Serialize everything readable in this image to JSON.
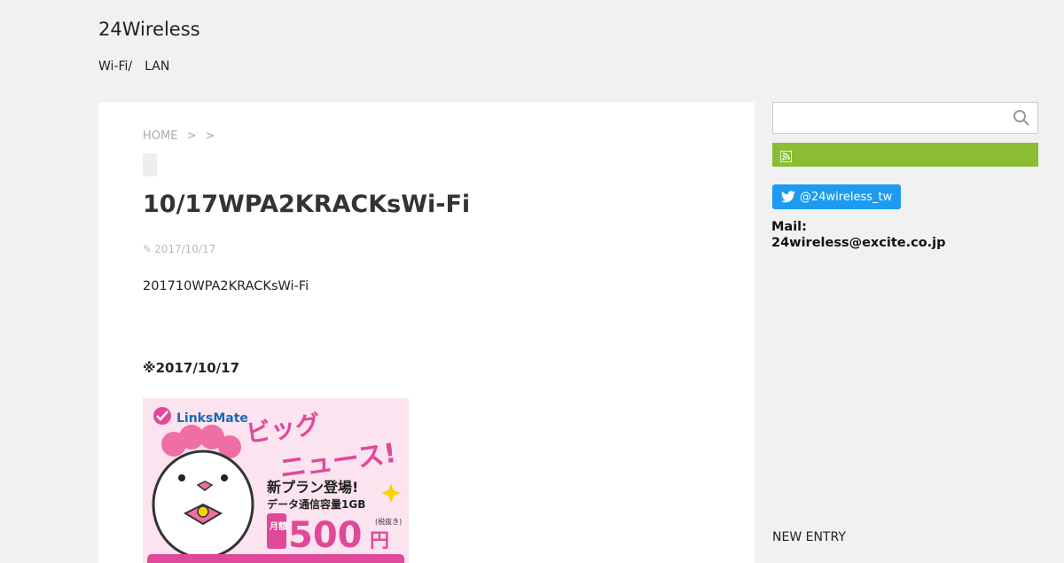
{
  "header": {
    "site_title": "24Wireless",
    "description": "Wi-Fi/　LAN"
  },
  "breadcrumb": {
    "home": "HOME",
    "separator1": ">",
    "separator2": ">"
  },
  "entry": {
    "title": "10/17WPA2KRACKsWi-Fi",
    "date": "2017/10/17",
    "body_text": "201710WPA2KRACKsWi-Fi",
    "note": "※2017/10/17"
  },
  "banner": {
    "brand": "LinksMate",
    "headline1": "ビッグ",
    "headline2": "ニュース!",
    "sub1": "新プラン登場!",
    "sub2": "データ通信容量1GB",
    "monthly": "月額",
    "price": "500",
    "yen": "円",
    "tax": "(税抜き)",
    "colors": {
      "pink": "#e0489a",
      "bg": "#fbe4ef",
      "yellow": "#f5d400"
    }
  },
  "sidebar": {
    "search_placeholder": "",
    "twitter_label": "@24wireless_tw",
    "mail_label": "Mail:",
    "mail_address": "24wireless@excite.co.jp",
    "new_entry_heading": "NEW ENTRY"
  },
  "colors": {
    "background": "#f1f1f1",
    "rss_green": "#8abd33",
    "twitter_blue": "#1d9bf0"
  }
}
